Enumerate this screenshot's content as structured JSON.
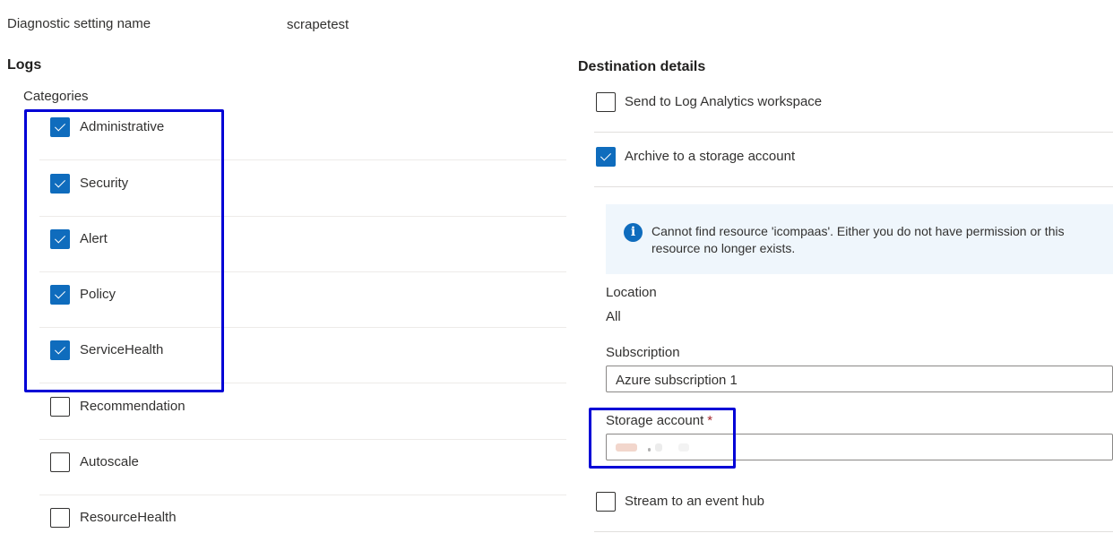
{
  "setting": {
    "label": "Diagnostic setting name",
    "value": "scrapetest"
  },
  "logs": {
    "title": "Logs",
    "categories_label": "Categories",
    "categories": [
      {
        "label": "Administrative",
        "checked": true
      },
      {
        "label": "Security",
        "checked": true
      },
      {
        "label": "Alert",
        "checked": true
      },
      {
        "label": "Policy",
        "checked": true
      },
      {
        "label": "ServiceHealth",
        "checked": true
      },
      {
        "label": "Recommendation",
        "checked": false
      },
      {
        "label": "Autoscale",
        "checked": false
      },
      {
        "label": "ResourceHealth",
        "checked": false
      }
    ]
  },
  "destination": {
    "title": "Destination details",
    "log_analytics": {
      "label": "Send to Log Analytics workspace",
      "checked": false
    },
    "storage_archive": {
      "label": "Archive to a storage account",
      "checked": true
    },
    "info_message": "Cannot find resource 'icompaas'. Either you do not have permission or this resource no longer exists.",
    "location_label": "Location",
    "location_value": "All",
    "subscription_label": "Subscription",
    "subscription_value": "Azure subscription 1",
    "storage_account_label": "Storage account",
    "required_marker": "*",
    "event_hub": {
      "label": "Stream to an event hub",
      "checked": false
    }
  },
  "colors": {
    "accent": "#0f6cbd",
    "highlight": "#0000d6",
    "info_bg": "#eff6fc",
    "required": "#a4262c"
  }
}
